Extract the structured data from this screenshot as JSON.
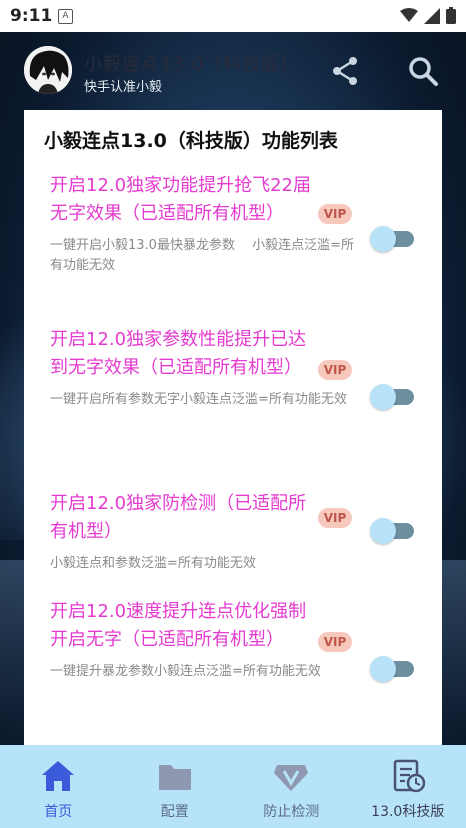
{
  "status_bar": {
    "time": "9:11",
    "notification_icon_letter": "A"
  },
  "header": {
    "title": "小毅连点13.0（科技版）",
    "subtitle": "快手认准小毅"
  },
  "card": {
    "title": "小毅连点13.0（科技版）功能列表",
    "items": [
      {
        "title": "开启12.0独家功能提升抢飞22届无字效果（已适配所有机型）",
        "badge": "VIP",
        "description": "一键开启小毅13.0最快暴龙参数　 小毅连点泛滥=所有功能无效",
        "enabled": false
      },
      {
        "title": "开启12.0独家参数性能提升已达到无字效果（已适配所有机型）",
        "badge": "VIP",
        "description": "一键开启所有参数无字小毅连点泛滥=所有功能无效",
        "enabled": false
      },
      {
        "title": "开启12.0独家防检测（已适配所有机型）",
        "badge": "VIP",
        "description": "小毅连点和参数泛滥=所有功能无效",
        "enabled": false
      },
      {
        "title": "开启12.0速度提升连点优化强制开启无字（已适配所有机型）",
        "badge": "VIP",
        "description": "一键提升暴龙参数小毅连点泛滥=所有功能无效",
        "enabled": false
      }
    ]
  },
  "bottom_nav": {
    "items": [
      {
        "label": "首页",
        "icon": "home-icon",
        "active": true
      },
      {
        "label": "配置",
        "icon": "folder-icon",
        "active": false
      },
      {
        "label": "防止检测",
        "icon": "vip-diamond-icon",
        "active": false
      },
      {
        "label": "13.0科技版",
        "icon": "document-clock-icon",
        "active": false
      }
    ]
  },
  "colors": {
    "accent_title": "#e53ad0",
    "nav_active": "#3b5bdb",
    "nav_inactive": "#6f7ea0",
    "nav_background": "#b6e3f8",
    "toggle_track": "#6d8f9f",
    "toggle_thumb": "#b7e2f7",
    "vip_badge": "#f7c9bd"
  }
}
